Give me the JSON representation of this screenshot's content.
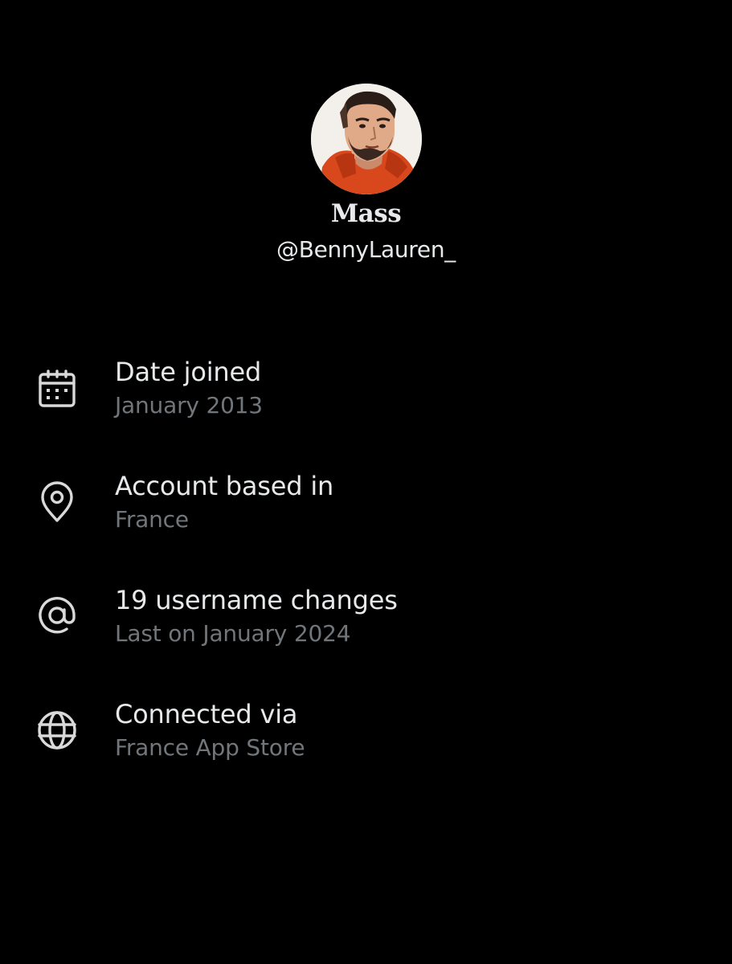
{
  "profile": {
    "display_name": "Mass",
    "handle": "@BennyLauren_"
  },
  "about": {
    "items": [
      {
        "icon": "calendar-icon",
        "title": "Date joined",
        "value": "January 2013"
      },
      {
        "icon": "location-pin-icon",
        "title": "Account based in",
        "value": "France"
      },
      {
        "icon": "at-sign-icon",
        "title": "19 username changes",
        "value": "Last on January 2024"
      },
      {
        "icon": "globe-icon",
        "title": "Connected via",
        "value": "France App Store"
      }
    ]
  },
  "colors": {
    "background": "#000000",
    "primary_text": "#e7e9ea",
    "secondary_text": "#71767b",
    "icon": "#d9d9d9"
  }
}
